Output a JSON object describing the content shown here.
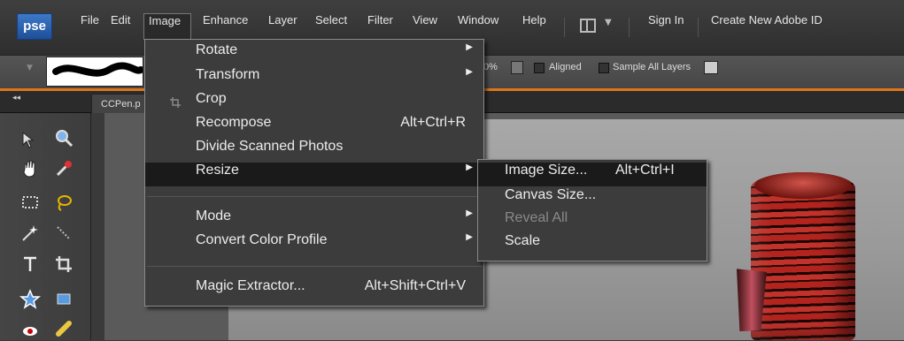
{
  "app": {
    "logo_text": "pse"
  },
  "menubar": {
    "items": [
      "File",
      "Edit",
      "Image",
      "Enhance",
      "Layer",
      "Select",
      "Filter",
      "View",
      "Window",
      "Help"
    ],
    "sign_in": "Sign In",
    "create_id": "Create New Adobe ID"
  },
  "options": {
    "opacity_partial": "0%",
    "aligned": "Aligned",
    "sample_all_layers": "Sample All Layers"
  },
  "document": {
    "tab_label": "CCPen.p"
  },
  "image_menu": {
    "rotate": "Rotate",
    "transform": "Transform",
    "crop": "Crop",
    "recompose": "Recompose",
    "recompose_shortcut": "Alt+Ctrl+R",
    "divide": "Divide Scanned Photos",
    "resize": "Resize",
    "mode": "Mode",
    "convert_profile": "Convert Color Profile",
    "magic_extractor": "Magic Extractor...",
    "magic_extractor_shortcut": "Alt+Shift+Ctrl+V"
  },
  "resize_menu": {
    "image_size": "Image Size...",
    "image_size_shortcut": "Alt+Ctrl+I",
    "canvas_size": "Canvas Size...",
    "reveal_all": "Reveal All",
    "scale": "Scale"
  },
  "colors": {
    "accent": "#e0741b",
    "logo": "#2f66b5"
  }
}
